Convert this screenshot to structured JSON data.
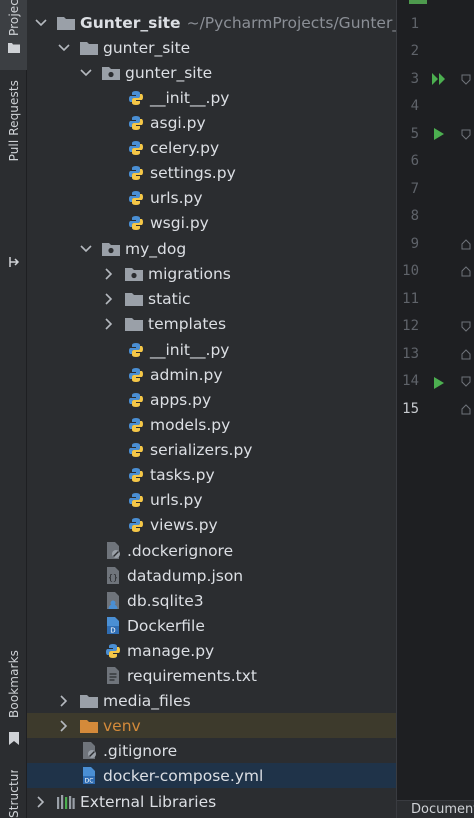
{
  "toolwindow_tabs": {
    "project": "Project",
    "pull_requests": "Pull Requests",
    "bookmarks": "Bookmarks",
    "structure": "Structure"
  },
  "tree": {
    "root": {
      "name": "Gunter_site",
      "path": "~/PycharmProjects/Gunter_site"
    },
    "items": [
      {
        "label": "gunter_site"
      },
      {
        "label": "gunter_site"
      },
      {
        "label": "__init__.py"
      },
      {
        "label": "asgi.py"
      },
      {
        "label": "celery.py"
      },
      {
        "label": "settings.py"
      },
      {
        "label": "urls.py"
      },
      {
        "label": "wsgi.py"
      },
      {
        "label": "my_dog"
      },
      {
        "label": "migrations"
      },
      {
        "label": "static"
      },
      {
        "label": "templates"
      },
      {
        "label": "__init__.py"
      },
      {
        "label": "admin.py"
      },
      {
        "label": "apps.py"
      },
      {
        "label": "models.py"
      },
      {
        "label": "serializers.py"
      },
      {
        "label": "tasks.py"
      },
      {
        "label": "urls.py"
      },
      {
        "label": "views.py"
      },
      {
        "label": ".dockerignore"
      },
      {
        "label": "datadump.json"
      },
      {
        "label": "db.sqlite3"
      },
      {
        "label": "Dockerfile"
      },
      {
        "label": "manage.py"
      },
      {
        "label": "requirements.txt"
      },
      {
        "label": "media_files"
      },
      {
        "label": "venv"
      },
      {
        "label": ".gitignore"
      },
      {
        "label": "docker-compose.yml"
      },
      {
        "label": "External Libraries"
      }
    ]
  },
  "gutter": {
    "line_numbers": [
      "1",
      "2",
      "3",
      "4",
      "5",
      "6",
      "7",
      "8",
      "9",
      "10",
      "11",
      "12",
      "13",
      "14",
      "15"
    ],
    "current_line": "15"
  },
  "bottom_tab": "Documentation",
  "colors": {
    "accent_green": "#4caf50",
    "folder": "#9aa0a8",
    "python_blue": "#4a8fd4",
    "python_yellow": "#f5c747",
    "selection": "#1f3349",
    "excluded_bg": "#3d3a2c",
    "excluded_text": "#d48a3a"
  }
}
